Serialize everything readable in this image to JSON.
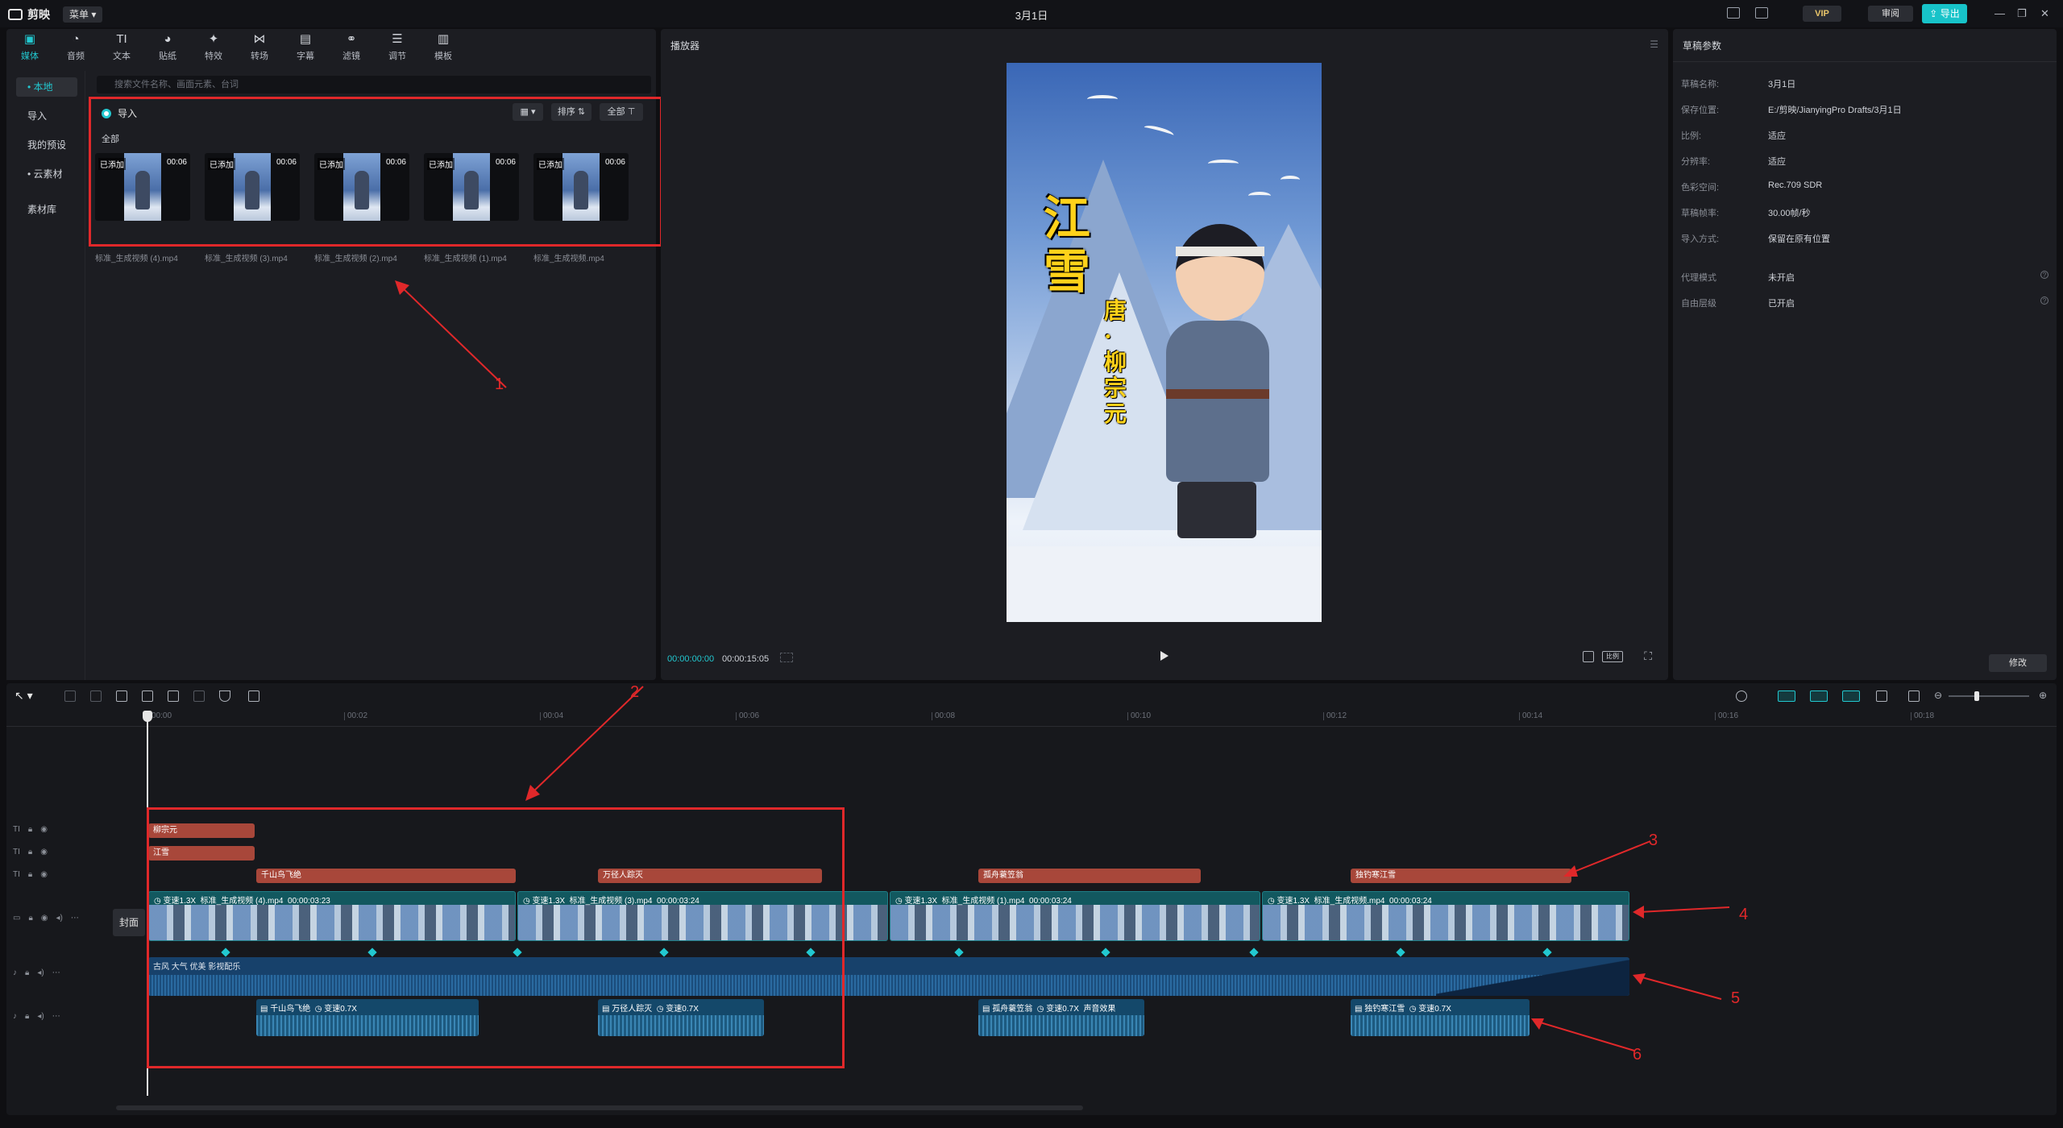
{
  "app": {
    "logo": "剪映",
    "menu_label": "菜单",
    "doc_title": "3月1日",
    "vip_label": "VIP",
    "review_label": "审阅",
    "export_label": "导出"
  },
  "toolbar_tabs": [
    {
      "label": "媒体",
      "icon": "media-icon"
    },
    {
      "label": "音频",
      "icon": "audio-icon"
    },
    {
      "label": "文本",
      "icon": "text-icon"
    },
    {
      "label": "贴纸",
      "icon": "sticker-icon"
    },
    {
      "label": "特效",
      "icon": "effects-icon"
    },
    {
      "label": "转场",
      "icon": "transition-icon"
    },
    {
      "label": "字幕",
      "icon": "caption-icon"
    },
    {
      "label": "滤镜",
      "icon": "filter-icon"
    },
    {
      "label": "调节",
      "icon": "adjust-icon"
    },
    {
      "label": "模板",
      "icon": "template-icon"
    }
  ],
  "sidenav": [
    "• 本地",
    "导入",
    "我的预设",
    "• 云素材",
    "素材库"
  ],
  "media": {
    "search_placeholder": "搜索文件名称、画面元素、台词",
    "import_label": "导入",
    "sort_label": "排序",
    "filter_label": "全部",
    "section_label": "全部",
    "items": [
      {
        "tag": "已添加",
        "duration": "00:06",
        "name": "标准_生成视频 (4).mp4"
      },
      {
        "tag": "已添加",
        "duration": "00:06",
        "name": "标准_生成视频 (3).mp4"
      },
      {
        "tag": "已添加",
        "duration": "00:06",
        "name": "标准_生成视频 (2).mp4"
      },
      {
        "tag": "已添加",
        "duration": "00:06",
        "name": "标准_生成视频 (1).mp4"
      },
      {
        "tag": "已添加",
        "duration": "00:06",
        "name": "标准_生成视频.mp4"
      }
    ]
  },
  "annotations": [
    "1",
    "2",
    "3",
    "4",
    "5",
    "6"
  ],
  "player": {
    "title": "播放器",
    "poem_title": "江雪",
    "poem_author": "唐·柳宗元",
    "time_current": "00:00:00:00",
    "time_total": "00:00:15:05",
    "ratio_label": "比例"
  },
  "properties": {
    "title": "草稿参数",
    "rows": [
      {
        "label": "草稿名称:",
        "value": "3月1日"
      },
      {
        "label": "保存位置:",
        "value": "E:/剪映/JianyingPro Drafts/3月1日"
      },
      {
        "label": "比例:",
        "value": "适应"
      },
      {
        "label": "分辨率:",
        "value": "适应"
      },
      {
        "label": "色彩空间:",
        "value": "Rec.709 SDR"
      },
      {
        "label": "草稿帧率:",
        "value": "30.00帧/秒"
      },
      {
        "label": "导入方式:",
        "value": "保留在原有位置"
      }
    ],
    "rows2": [
      {
        "label": "代理模式",
        "value": "未开启"
      },
      {
        "label": "自由层级",
        "value": "已开启"
      }
    ],
    "modify_label": "修改"
  },
  "timeline": {
    "ruler": [
      "00:00",
      "00:02",
      "00:04",
      "00:06",
      "00:08",
      "00:10",
      "00:12",
      "00:14",
      "00:16",
      "00:18"
    ],
    "cover_label": "封面",
    "text_track1": "柳宗元",
    "text_track2": "江雪",
    "text_track3": [
      "千山鸟飞绝",
      "万径人踪灭",
      "孤舟蓑笠翁",
      "独钓寒江雪"
    ],
    "video_clips": [
      {
        "speed": "变速1.3X",
        "name": "标准_生成视频 (4).mp4",
        "duration": "00:00:03:23"
      },
      {
        "speed": "变速1.3X",
        "name": "标准_生成视频 (3).mp4",
        "duration": "00:00:03:24"
      },
      {
        "speed": "变速1.3X",
        "name": "标准_生成视频 (1).mp4",
        "duration": "00:00:03:24"
      },
      {
        "speed": "变速1.3X",
        "name": "标准_生成视频.mp4",
        "duration": "00:00:03:24"
      }
    ],
    "music_clip": "古风 大气 优美 影视配乐",
    "voice_clips": [
      {
        "name": "千山鸟飞绝",
        "speed": "变速0.7X",
        "extra": ""
      },
      {
        "name": "万径人踪灭",
        "speed": "变速0.7X",
        "extra": ""
      },
      {
        "name": "孤舟蓑笠翁",
        "speed": "变速0.7X",
        "extra": "声音效果"
      },
      {
        "name": "独钓寒江雪",
        "speed": "变速0.7X",
        "extra": ""
      }
    ]
  },
  "colors": {
    "accent": "#22c8d0",
    "annotation": "#e0282a",
    "text_clip": "#a8473a",
    "video_clip": "#12585f",
    "audio_clip": "#17416b"
  }
}
